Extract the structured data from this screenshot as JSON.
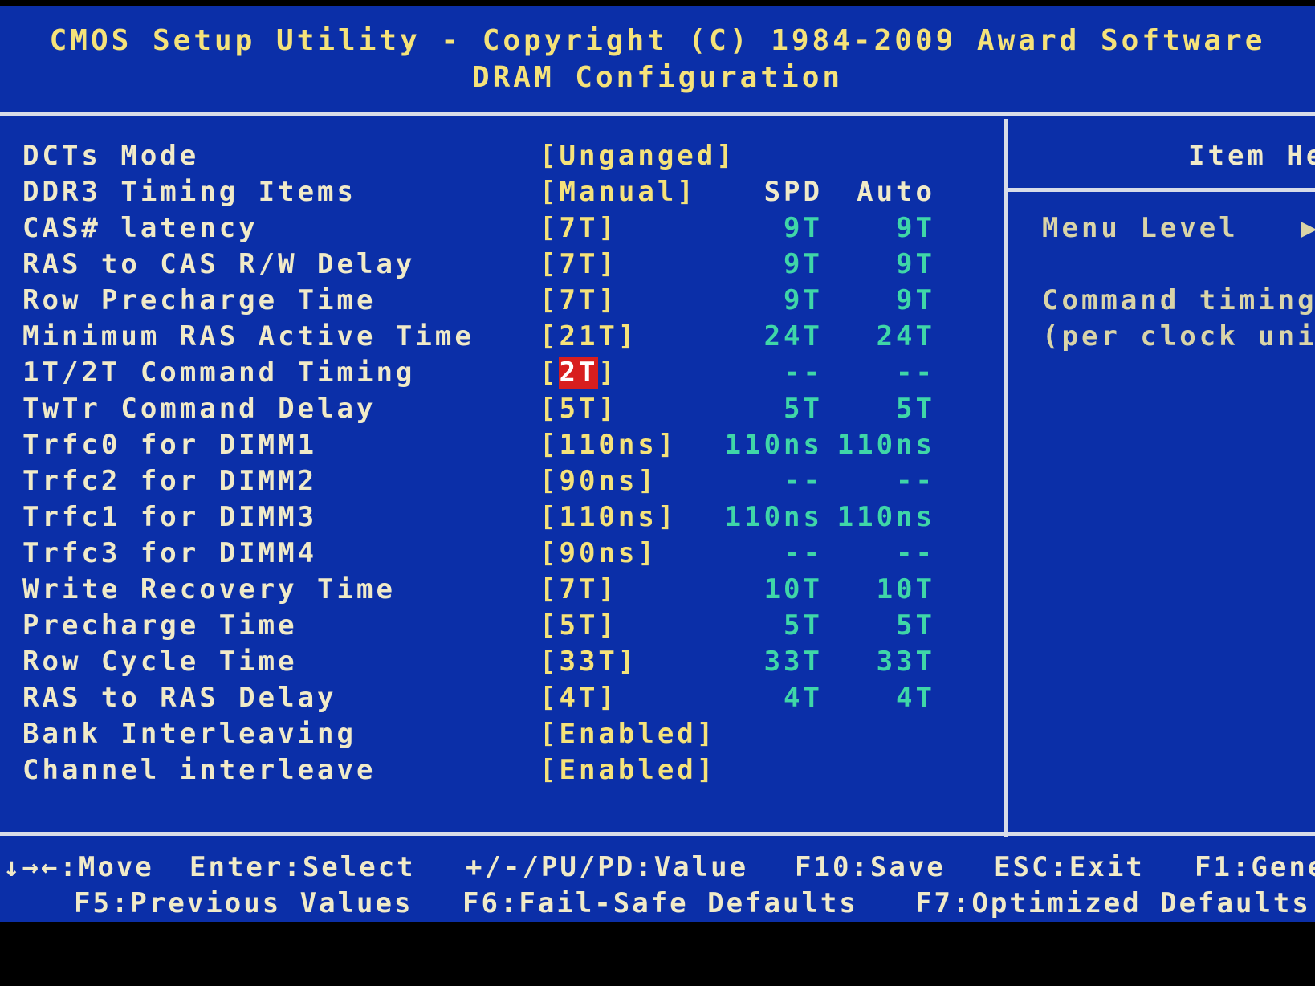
{
  "header": {
    "title": "CMOS Setup Utility - Copyright (C) 1984-2009 Award Software",
    "subtitle": "DRAM Configuration"
  },
  "items": [
    {
      "label": "DCTs Mode",
      "value": "[Unganged]",
      "spd": "",
      "auto": ""
    },
    {
      "label": "DDR3 Timing Items",
      "value": "[Manual]",
      "spd": "SPD",
      "auto": "Auto"
    },
    {
      "label": "CAS# latency",
      "value": "[7T]",
      "spd": "9T",
      "auto": "9T"
    },
    {
      "label": "RAS to CAS R/W Delay",
      "value": "[7T]",
      "spd": "9T",
      "auto": "9T"
    },
    {
      "label": "Row Precharge Time",
      "value": "[7T]",
      "spd": "9T",
      "auto": "9T"
    },
    {
      "label": "Minimum RAS Active Time",
      "value": "[21T]",
      "spd": "24T",
      "auto": "24T"
    },
    {
      "label": "1T/2T Command Timing",
      "value_open": "[",
      "value_selected": "2T",
      "value_close": "]",
      "spd": "--",
      "auto": "--"
    },
    {
      "label": "TwTr Command Delay",
      "value": "[5T]",
      "spd": "5T",
      "auto": "5T"
    },
    {
      "label": "Trfc0 for DIMM1",
      "value": "[110ns]",
      "spd": "110ns",
      "auto": "110ns"
    },
    {
      "label": "Trfc2 for DIMM2",
      "value": "[90ns]",
      "spd": "--",
      "auto": "--"
    },
    {
      "label": "Trfc1 for DIMM3",
      "value": "[110ns]",
      "spd": "110ns",
      "auto": "110ns"
    },
    {
      "label": "Trfc3 for DIMM4",
      "value": "[90ns]",
      "spd": "--",
      "auto": "--"
    },
    {
      "label": "Write Recovery Time",
      "value": "[7T]",
      "spd": "10T",
      "auto": "10T"
    },
    {
      "label": "Precharge Time",
      "value": "[5T]",
      "spd": "5T",
      "auto": "5T"
    },
    {
      "label": "Row Cycle Time",
      "value": "[33T]",
      "spd": "33T",
      "auto": "33T"
    },
    {
      "label": "RAS to RAS Delay",
      "value": "[4T]",
      "spd": "4T",
      "auto": "4T"
    },
    {
      "label": "Bank Interleaving",
      "value": "[Enabled]",
      "spd": "",
      "auto": ""
    },
    {
      "label": "Channel interleave",
      "value": "[Enabled]",
      "spd": "",
      "auto": ""
    }
  ],
  "help_panel": {
    "title": "Item He",
    "menu_level": "Menu Level",
    "menu_level_marker": "▶",
    "line1": "Command timing",
    "line2": "(per clock uni"
  },
  "footer": {
    "move": "↓→←:Move",
    "select": "Enter:Select",
    "value": "+/-/PU/PD:Value",
    "save": "F10:Save",
    "exit": "ESC:Exit",
    "general": "F1:Gene",
    "previous": "F5:Previous Values",
    "failsafe": "F6:Fail-Safe Defaults",
    "optimized": "F7:Optimized Defaults"
  },
  "colors": {
    "background": "#0b2fa8",
    "value_yellow": "#f5e27a",
    "label_white": "#f0eac8",
    "spd_green": "#3fd6a8",
    "highlight_red": "#d81e1e"
  }
}
